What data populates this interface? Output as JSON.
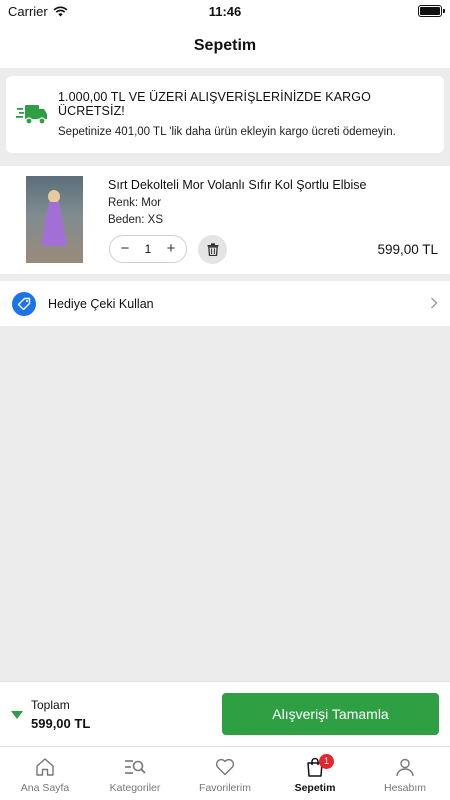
{
  "status_bar": {
    "carrier": "Carrier",
    "time": "11:46"
  },
  "header": {
    "title": "Sepetim"
  },
  "shipping_banner": {
    "title": "1.000,00 TL VE ÜZERİ ALIŞVERİŞLERİNİZDE KARGO ÜCRETSİZ!",
    "subtitle": "Sepetinize 401,00 TL 'lik daha ürün ekleyin kargo ücreti ödemeyin.",
    "icon": "truck-icon",
    "accent_color": "#2ea043"
  },
  "cart": {
    "items": [
      {
        "name": "Sırt Dekolteli Mor Volanlı Sıfır Kol Şortlu Elbise",
        "color_label": "Renk: Mor",
        "size_label": "Beden: XS",
        "quantity": "1",
        "price": "599,00 TL"
      }
    ]
  },
  "gift_card": {
    "label": "Hediye Çeki Kullan",
    "icon": "tag-icon"
  },
  "summary": {
    "total_label": "Toplam",
    "total_value": "599,00 TL",
    "checkout_label": "Alışverişi Tamamla"
  },
  "tabbar": {
    "items": [
      {
        "label": "Ana Sayfa",
        "icon": "home-icon"
      },
      {
        "label": "Kategoriler",
        "icon": "categories-search-icon"
      },
      {
        "label": "Favorilerim",
        "icon": "heart-icon"
      },
      {
        "label": "Sepetim",
        "icon": "cart-bag-icon",
        "badge": "1",
        "active": true
      },
      {
        "label": "Hesabım",
        "icon": "user-icon"
      }
    ]
  },
  "colors": {
    "primary_green": "#2ea043",
    "badge_red": "#e5252a",
    "gift_blue": "#1a73e8"
  }
}
